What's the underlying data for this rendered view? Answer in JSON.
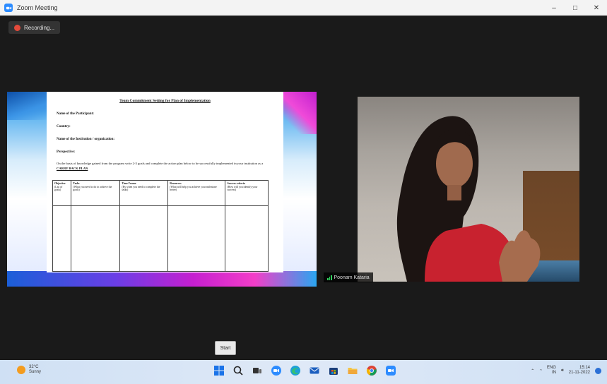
{
  "window": {
    "title": "Zoom Meeting",
    "minimize_glyph": "–",
    "maximize_glyph": "□",
    "close_glyph": "✕"
  },
  "recording": {
    "label": "Recording..."
  },
  "shared_doc": {
    "title": "Team Commitment Setting for Plan of Implementation",
    "fields": [
      "Name of the Participant:",
      "Country:",
      "Name of the Institution / organization:",
      "Perspective:"
    ],
    "paragraph": "On the basis of knowledge gained from the program write 2-3 goals and complete the action plan below to be successfully implemented in your institution as a",
    "paragraph_highlight": "CARRY BACK PLAN",
    "table_headers": [
      {
        "title": "Objective",
        "desc": "(List of goals)"
      },
      {
        "title": "Tasks",
        "desc": "(What you need to do to achieve the goals)"
      },
      {
        "title": "Time Frame",
        "desc": "(By when you need to complete the tasks)"
      },
      {
        "title": "Resources",
        "desc": "(What will help you achieve your milestone better)"
      },
      {
        "title": "Success criteria",
        "desc": "(How will you identify your success)"
      }
    ]
  },
  "participant": {
    "name": "Poonam Kataria"
  },
  "zoom_button": {
    "label": "Start"
  },
  "taskbar": {
    "weather_temp": "32°C",
    "weather_desc": "Sunny",
    "tray_lang": "ENG",
    "tray_region": "IN",
    "time": "15:14",
    "date": "21-11-2022",
    "apps": [
      "windows-start-icon",
      "search-icon",
      "file-explorer-icon",
      "zoom-icon",
      "edge-icon",
      "mail-icon",
      "store-icon",
      "folder-icon",
      "chrome-icon",
      "zoom-app-icon"
    ]
  },
  "colors": {
    "meeting_bg": "#1a1a1a",
    "recording_dot": "#e44a3b",
    "zoom_blue": "#2d8cff"
  }
}
